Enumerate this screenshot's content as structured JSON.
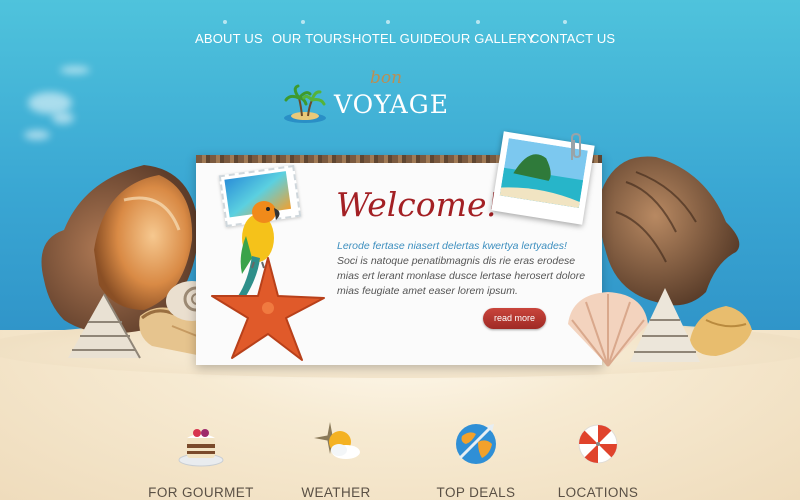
{
  "nav": {
    "items": [
      {
        "label": "ABOUT US"
      },
      {
        "label": "OUR TOURS"
      },
      {
        "label": "HOTEL GUIDE"
      },
      {
        "label": "OUR GALLERY"
      },
      {
        "label": "CONTACT US"
      }
    ]
  },
  "logo": {
    "script": "bon",
    "name": "VOYAGE"
  },
  "card": {
    "title": "Welcome!",
    "lead": "Lerode fertase niasert delertas kwertya lertyades!",
    "body": "Soci is natoque penatibmagnis dis rie eras erodese mias ert lerant monlase dusce lertase herosert dolore mias feugiate amet easer lorem ipsum.",
    "button_label": "read more"
  },
  "features": [
    {
      "label": "FOR GOURMET",
      "icon": "cake-icon"
    },
    {
      "label": "WEATHER",
      "icon": "weather-icon"
    },
    {
      "label": "TOP DEALS",
      "icon": "globe-icon"
    },
    {
      "label": "LOCATIONS",
      "icon": "beach-umbrella-icon"
    }
  ],
  "colors": {
    "sky": "#3aa7d3",
    "sand": "#f4e6cc",
    "accent_red": "#a32024",
    "link_blue": "#3d8fbf",
    "button": "#b8372f"
  }
}
